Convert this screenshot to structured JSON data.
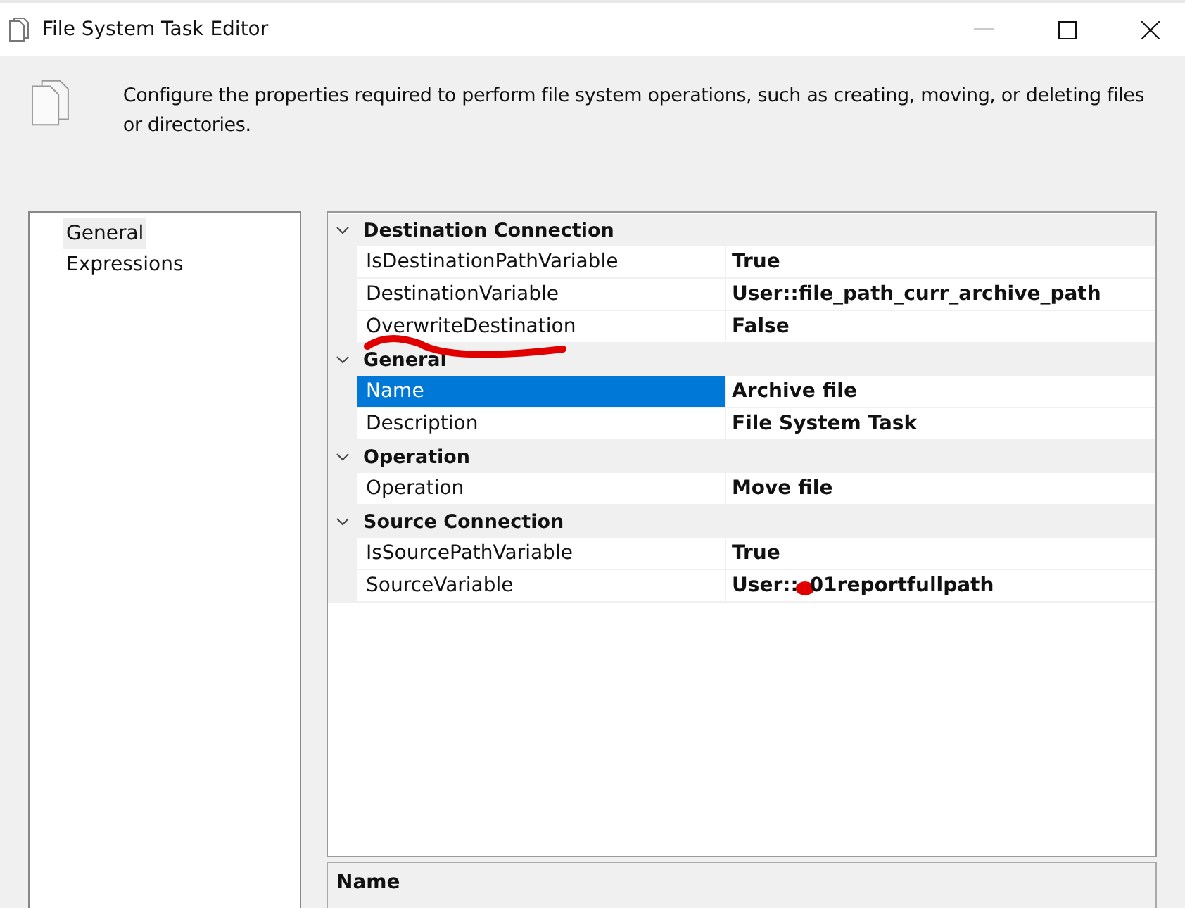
{
  "window": {
    "title": "File System Task Editor"
  },
  "header": {
    "description": "Configure the properties required to perform file system operations, such as creating, moving, or deleting files or directories."
  },
  "sidebar": {
    "items": [
      {
        "label": "General",
        "selected": true
      },
      {
        "label": "Expressions",
        "selected": false
      }
    ]
  },
  "property_grid": {
    "categories": [
      {
        "name": "Destination Connection",
        "expanded": true,
        "properties": [
          {
            "name": "IsDestinationPathVariable",
            "value": "True",
            "selected": false,
            "underlined": false,
            "redacted": false
          },
          {
            "name": "DestinationVariable",
            "value": "User::file_path_curr_archive_path",
            "selected": false,
            "underlined": false,
            "redacted": false
          },
          {
            "name": "OverwriteDestination",
            "value": "False",
            "selected": false,
            "underlined": true,
            "redacted": false
          }
        ]
      },
      {
        "name": "General",
        "expanded": true,
        "properties": [
          {
            "name": "Name",
            "value": "Archive file",
            "selected": true,
            "underlined": false,
            "redacted": false
          },
          {
            "name": "Description",
            "value": "File System Task",
            "selected": false,
            "underlined": false,
            "redacted": false
          }
        ]
      },
      {
        "name": "Operation",
        "expanded": true,
        "properties": [
          {
            "name": "Operation",
            "value": "Move file",
            "selected": false,
            "underlined": false,
            "redacted": false
          }
        ]
      },
      {
        "name": "Source Connection",
        "expanded": true,
        "properties": [
          {
            "name": "IsSourcePathVariable",
            "value": "True",
            "selected": false,
            "underlined": false,
            "redacted": false
          },
          {
            "name": "SourceVariable",
            "value": "User::",
            "value_tail": "01reportfullpath",
            "selected": false,
            "underlined": false,
            "redacted": true
          }
        ]
      }
    ]
  },
  "description_pane": {
    "title": "Name"
  }
}
